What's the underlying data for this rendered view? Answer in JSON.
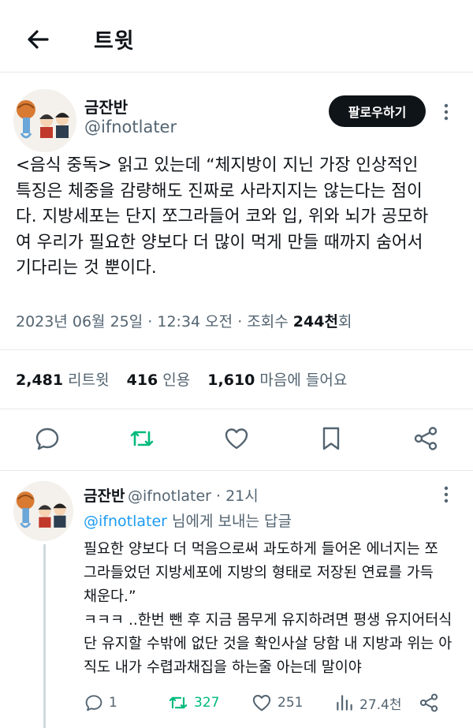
{
  "header": {
    "title": "트윗"
  },
  "tweet": {
    "author_name": "금잔반",
    "author_handle": "@ifnotlater",
    "follow_label": "팔로우하기",
    "text_lines": [
      "<음식 중독> 읽고 있는데 “체지방이 지닌 가장 인상적인",
      "특징은 체중을 감량해도 진짜로 사라지지는 않는다는 점이",
      "다. 지방세포는 단지 쪼그라들어 코와 입, 위와 뇌가 공모하",
      "여 우리가 필요한 양보다 더 많이 먹게 만들 때까지 숨어서",
      "기다리는 것 뿐이다."
    ],
    "date": "2023년 06월 25일",
    "time": "12:34 오전",
    "views_label": "조회수",
    "views_count": "244천",
    "views_suffix": "회",
    "retweets_count": "2,481",
    "retweets_label": "리트윗",
    "quotes_count": "416",
    "quotes_label": "인용",
    "likes_count": "1,610",
    "likes_label": "마음에 들어요"
  },
  "reply": {
    "author_name": "금잔반",
    "author_handle": "@ifnotlater",
    "time": "21시",
    "reply_to_handle": "@ifnotlater",
    "reply_to_suffix": "님에게 보내는 답글",
    "text_lines": [
      "필요한 양보다 더 먹음으로써 과도하게 들어온 에너지는 쪼",
      "그라들었던 지방세포에 지방의 형태로 저장된 연료를 가득",
      "채운다.”",
      "ㅋㅋㅋ ..한번 뺀 후 지금 몸무게 유지하려면 평생 유지어터식",
      "단 유지할 수밖에 없단 것을 확인사살 당함 내 지방과 위는 아",
      "직도 내가 수렵과채집을 하는줄 아는데 말이야"
    ],
    "replies_count": "1",
    "retweets_count": "327",
    "likes_count": "251",
    "views_count": "27.4천"
  },
  "colors": {
    "accent": "#1d9bf0",
    "retweet_green": "#00ba7c",
    "text": "#0f1419",
    "secondary": "#536471"
  }
}
